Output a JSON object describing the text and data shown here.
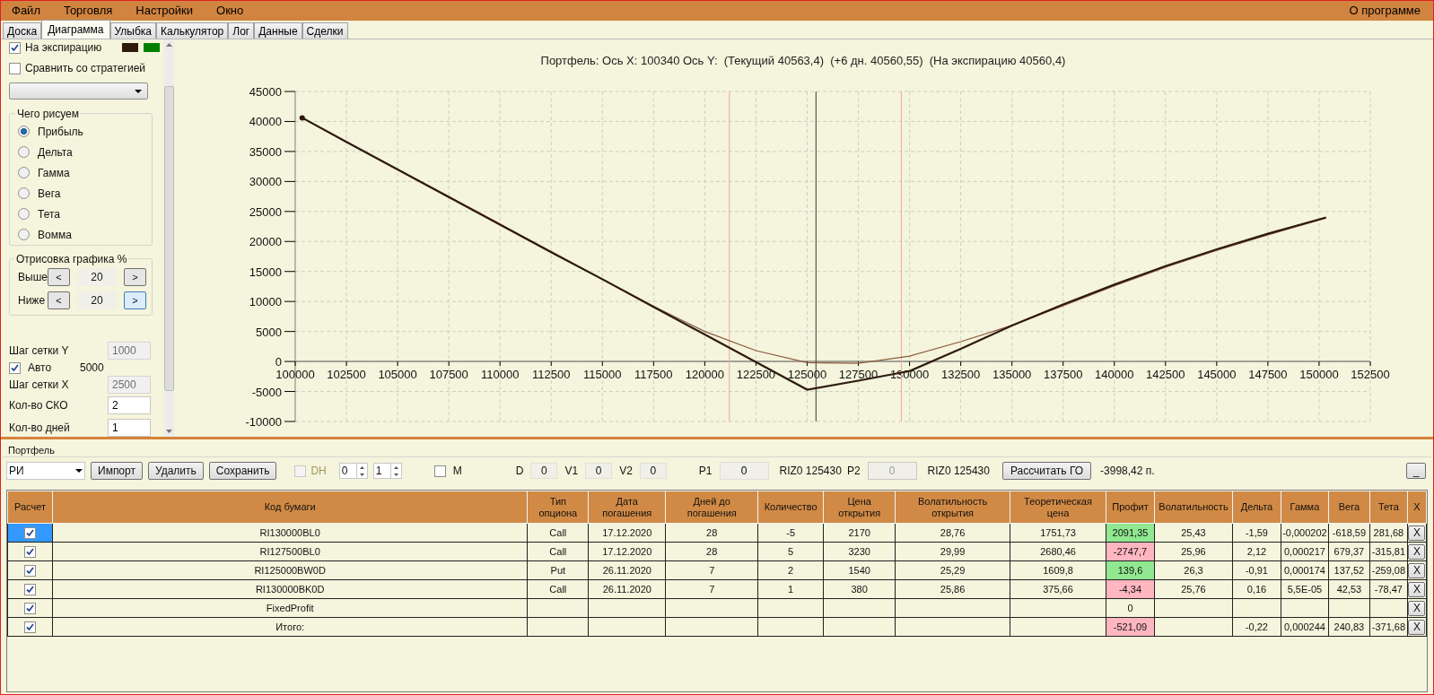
{
  "menu": [
    {
      "label": "Файл"
    },
    {
      "label": "Торговля"
    },
    {
      "label": "Настройки"
    },
    {
      "label": "Окно"
    }
  ],
  "about": "О программе",
  "tabs": [
    {
      "label": "Доска",
      "selected": false
    },
    {
      "label": "Диаграмма",
      "selected": true
    },
    {
      "label": "Улыбка",
      "selected": false
    },
    {
      "label": "Калькулятор",
      "selected": false
    },
    {
      "label": "Лог",
      "selected": false
    },
    {
      "label": "Данные",
      "selected": false
    },
    {
      "label": "Сделки",
      "selected": false
    }
  ],
  "left_panel": {
    "expiration": {
      "label": "На экспирацию",
      "checked": true,
      "swatches": [
        {
          "color": "#2e1a0e"
        },
        {
          "color": "#008000"
        }
      ]
    },
    "compare": {
      "label": "Сравнить со стратегией",
      "checked": false
    },
    "draw_group": {
      "title": "Чего рисуем",
      "options": [
        {
          "label": "Прибыль",
          "selected": true
        },
        {
          "label": "Дельта",
          "selected": false
        },
        {
          "label": "Гамма",
          "selected": false
        },
        {
          "label": "Вега",
          "selected": false
        },
        {
          "label": "Тета",
          "selected": false
        },
        {
          "label": "Вомма",
          "selected": false
        }
      ]
    },
    "range_group": {
      "title": "Отрисовка графика %",
      "rows": [
        {
          "label": "Выше",
          "minus": "<",
          "value": "20",
          "plus": ">",
          "plus_hover": false
        },
        {
          "label": "Ниже",
          "minus": "<",
          "value": "20",
          "plus": ">",
          "plus_hover": true
        }
      ]
    },
    "grid_y": {
      "label": "Шаг сетки Y",
      "value": "1000",
      "disabled": true
    },
    "auto": {
      "label": "Авто",
      "checked": true,
      "value": "5000"
    },
    "grid_x": {
      "label": "Шаг сетки X",
      "value": "2500",
      "disabled": true
    },
    "sko": {
      "label": "Кол-во СКО",
      "value": "2",
      "disabled": false
    },
    "days": {
      "label": "Кол-во дней",
      "value": "1",
      "disabled": false
    }
  },
  "chart": {
    "chart_data": {
      "type": "line",
      "title": "Портфель: Ось X: 100340 Ось Y:  (Текущий 40563,4)  (+6 дн. 40560,55)  (На экспирацию 40560,4)",
      "x": [
        100340,
        102500,
        105000,
        107500,
        110000,
        112500,
        115000,
        117500,
        120000,
        122500,
        125000,
        127500,
        130000,
        132500,
        135000,
        137500,
        140000,
        142500,
        145000,
        147500,
        150340
      ],
      "series": [
        {
          "color": "#8b5a3c",
          "values": [
            40600,
            36600,
            32000,
            27500,
            22900,
            18300,
            13700,
            9200,
            5000,
            1800,
            -200,
            -300,
            900,
            3300,
            6000,
            9300,
            12600,
            15700,
            18500,
            21100,
            23900
          ]
        },
        {
          "color": "#2e1a0e",
          "values": [
            40600,
            36600,
            32000,
            27400,
            22800,
            18200,
            13700,
            9100,
            4500,
            -100,
            -4700,
            -3200,
            -1600,
            2100,
            6000,
            9500,
            12800,
            15900,
            18700,
            21300,
            24000
          ]
        }
      ],
      "xlim": [
        100000,
        152500
      ],
      "ylim": [
        -10000,
        45000
      ],
      "xticks": [
        100000,
        102500,
        105000,
        107500,
        110000,
        112500,
        115000,
        117500,
        120000,
        122500,
        125000,
        127500,
        130000,
        132500,
        135000,
        137500,
        140000,
        142500,
        145000,
        147500,
        150000,
        152500
      ],
      "yticks": [
        -10000,
        -5000,
        0,
        5000,
        10000,
        15000,
        20000,
        25000,
        30000,
        35000,
        40000,
        45000
      ],
      "grid": true,
      "ref_lines": [
        {
          "axis": "x",
          "value": 121200,
          "color": "#f4a6a6"
        },
        {
          "axis": "x",
          "value": 125430,
          "color": "#3a3a3a"
        },
        {
          "axis": "x",
          "value": 129600,
          "color": "#f4a6a6"
        }
      ]
    }
  },
  "portfolio": {
    "title": "Портфель",
    "instrument": "РИ",
    "buttons": [
      {
        "label": "Импорт"
      },
      {
        "label": "Удалить"
      },
      {
        "label": "Сохранить"
      }
    ],
    "dh": {
      "label": "DH",
      "checked": false,
      "disabled": true
    },
    "spinners": [
      {
        "value": "0"
      },
      {
        "value": "1"
      }
    ],
    "m": {
      "label": "M",
      "checked": false
    },
    "fields": [
      {
        "label": "D",
        "value": "0"
      },
      {
        "label": "V1",
        "value": "0"
      },
      {
        "label": "V2",
        "value": "0"
      }
    ],
    "prices": [
      {
        "label": "P1",
        "value": "0",
        "disabled": false,
        "ticker": "RIZ0 125430"
      },
      {
        "label": "P2",
        "value": "0",
        "disabled": true,
        "ticker": "RIZ0 125430"
      }
    ],
    "calc_button": "Рассчитать ГО",
    "margin": "-3998,42 п.",
    "minimize": "_"
  },
  "table": {
    "columns": [
      "Расчет",
      "Код бумаги",
      "Тип опциона",
      "Дата погашения",
      "Дней до погашения",
      "Количество",
      "Цена открытия",
      "Волатильность открытия",
      "Теоретическая цена",
      "Профит",
      "Волатильность",
      "Дельта",
      "Гамма",
      "Вега",
      "Тета",
      "X"
    ],
    "rows": [
      {
        "cells": [
          {
            "kind": "check",
            "checked": true,
            "selected": true
          },
          "RI130000BL0",
          "Call",
          "17.12.2020",
          "28",
          "-5",
          "2170",
          "28,76",
          "1751,73",
          {
            "kind": "profit",
            "text": "2091,35",
            "color": "#90e890"
          },
          "25,43",
          "-1,59",
          "-0,000202",
          "-618,59",
          "281,68",
          {
            "kind": "remove",
            "text": "X"
          }
        ]
      },
      {
        "cells": [
          {
            "kind": "check",
            "checked": true,
            "selected": false
          },
          "RI127500BL0",
          "Call",
          "17.12.2020",
          "28",
          "5",
          "3230",
          "29,99",
          "2680,46",
          {
            "kind": "profit",
            "text": "-2747,7",
            "color": "#ffb6c1"
          },
          "25,96",
          "2,12",
          "0,000217",
          "679,37",
          "-315,81",
          {
            "kind": "remove",
            "text": "X"
          }
        ]
      },
      {
        "cells": [
          {
            "kind": "check",
            "checked": true,
            "selected": false
          },
          "RI125000BW0D",
          "Put",
          "26.11.2020",
          "7",
          "2",
          "1540",
          "25,29",
          "1609,8",
          {
            "kind": "profit",
            "text": "139,6",
            "color": "#90e890"
          },
          "26,3",
          "-0,91",
          "0,000174",
          "137,52",
          "-259,08",
          {
            "kind": "remove",
            "text": "X"
          }
        ]
      },
      {
        "cells": [
          {
            "kind": "check",
            "checked": true,
            "selected": false
          },
          "RI130000BK0D",
          "Call",
          "26.11.2020",
          "7",
          "1",
          "380",
          "25,86",
          "375,66",
          {
            "kind": "profit",
            "text": "-4,34",
            "color": "#ffb6c1"
          },
          "25,76",
          "0,16",
          "5,5E-05",
          "42,53",
          "-78,47",
          {
            "kind": "remove",
            "text": "X"
          }
        ]
      },
      {
        "cells": [
          {
            "kind": "check",
            "checked": true,
            "selected": false
          },
          "FixedProfit",
          null,
          null,
          null,
          null,
          null,
          null,
          null,
          "0",
          null,
          null,
          null,
          null,
          null,
          {
            "kind": "remove",
            "text": "X"
          }
        ]
      },
      {
        "cells": [
          {
            "kind": "check",
            "checked": true,
            "selected": false
          },
          "Итого:",
          null,
          null,
          null,
          null,
          null,
          null,
          null,
          {
            "kind": "profit",
            "text": "-521,09",
            "color": "#ffb6c1"
          },
          null,
          "-0,22",
          "0,000244",
          "240,83",
          "-371,68",
          {
            "kind": "remove",
            "text": "X"
          }
        ]
      }
    ]
  }
}
